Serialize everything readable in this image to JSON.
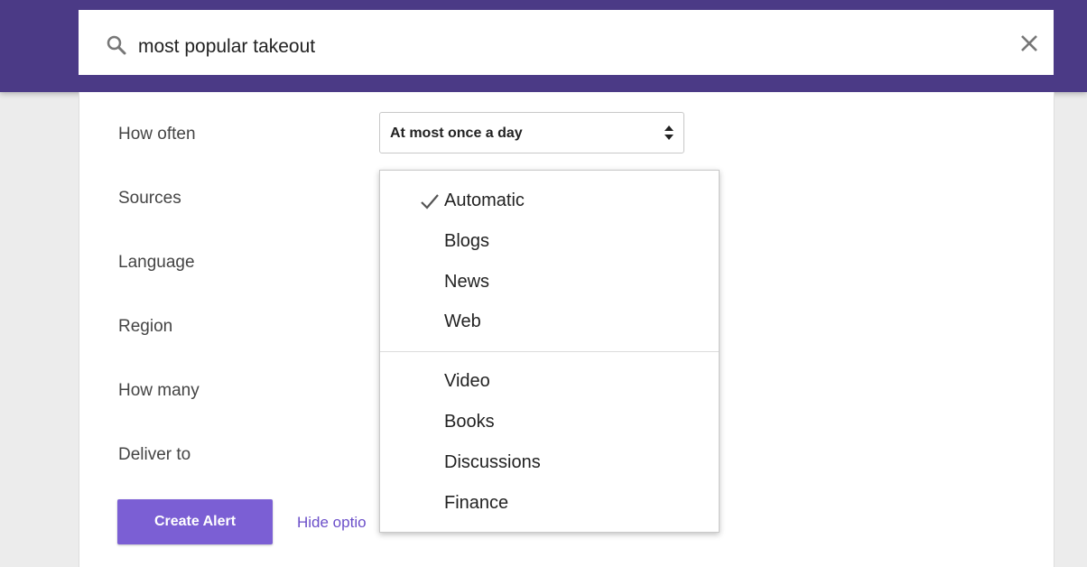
{
  "search": {
    "query": "most popular takeout"
  },
  "options": {
    "labels": [
      "How often",
      "Sources",
      "Language",
      "Region",
      "How many",
      "Deliver to"
    ],
    "how_often_value": "At most once a day"
  },
  "actions": {
    "create_label": "Create Alert",
    "hide_label": "Hide optio"
  },
  "dropdown": {
    "selected": "Automatic",
    "group1": [
      "Automatic",
      "Blogs",
      "News",
      "Web"
    ],
    "group2": [
      "Video",
      "Books",
      "Discussions",
      "Finance"
    ]
  },
  "colors": {
    "brand": "#4b3a86",
    "accent": "#7b5fd4",
    "link": "#6b4fc9"
  }
}
